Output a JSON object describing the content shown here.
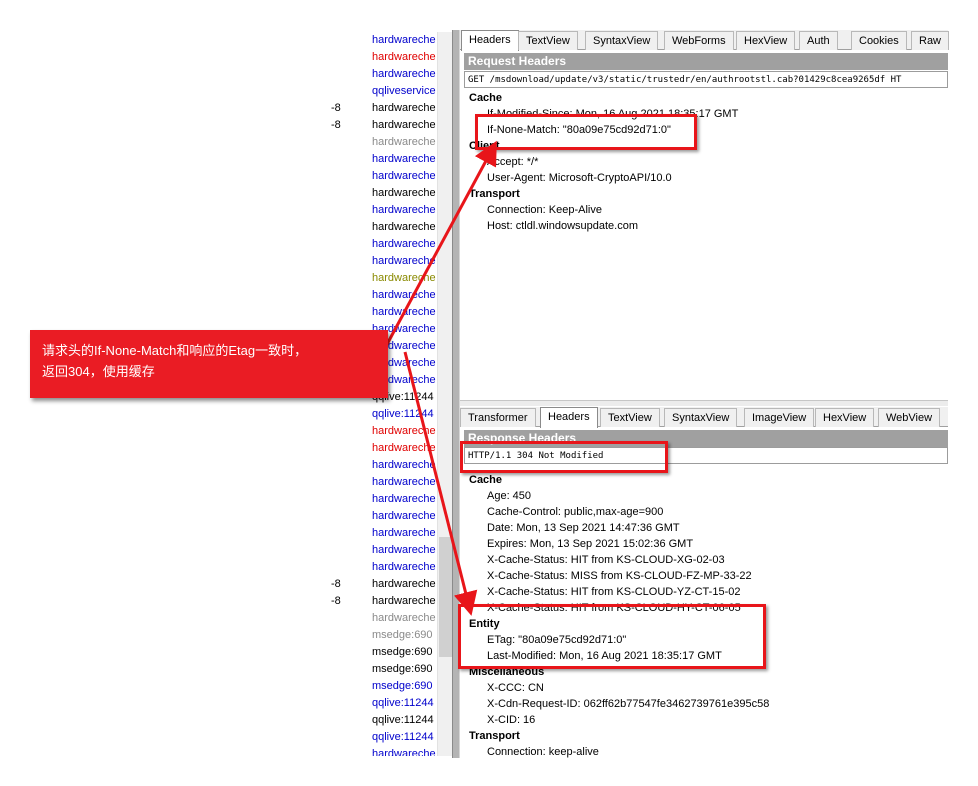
{
  "session_list": {
    "rows": [
      {
        "prefix": "",
        "host": "hardwareche",
        "color": "#0000cc"
      },
      {
        "prefix": "",
        "host": "hardwareche",
        "color": "#e00000"
      },
      {
        "prefix": "",
        "host": "hardwareche",
        "color": "#0000cc"
      },
      {
        "prefix": "",
        "host": "qqliveservice",
        "color": "#0000cc"
      },
      {
        "prefix": "-8",
        "host": "hardwareche",
        "color": "#000000"
      },
      {
        "prefix": "-8",
        "host": "hardwareche",
        "color": "#000000"
      },
      {
        "prefix": "",
        "host": "hardwareche",
        "color": "#8a8a8a"
      },
      {
        "prefix": "",
        "host": "hardwareche",
        "color": "#0000cc"
      },
      {
        "prefix": "",
        "host": "hardwareche",
        "color": "#0000cc"
      },
      {
        "prefix": "",
        "host": "hardwareche",
        "color": "#000000"
      },
      {
        "prefix": "",
        "host": "hardwareche",
        "color": "#0000cc"
      },
      {
        "prefix": "",
        "host": "hardwareche",
        "color": "#000000"
      },
      {
        "prefix": "",
        "host": "hardwareche",
        "color": "#0000cc"
      },
      {
        "prefix": "",
        "host": "hardwareche",
        "color": "#0000cc"
      },
      {
        "prefix": "",
        "host": "hardwareche",
        "color": "#8a8a00"
      },
      {
        "prefix": "",
        "host": "hardwareche",
        "color": "#0000cc"
      },
      {
        "prefix": "",
        "host": "hardwareche",
        "color": "#0000cc"
      },
      {
        "prefix": "",
        "host": "hardwareche",
        "color": "#0000cc"
      },
      {
        "prefix": "",
        "host": "hardwareche",
        "color": "#0000cc"
      },
      {
        "prefix": "",
        "host": "hardwareche",
        "color": "#0000cc"
      },
      {
        "prefix": "",
        "host": "hardwareche",
        "color": "#0000cc"
      },
      {
        "prefix": "",
        "host": "qqlive:11244",
        "color": "#000000"
      },
      {
        "prefix": "",
        "host": "qqlive:11244",
        "color": "#0000cc"
      },
      {
        "prefix": "",
        "host": "hardwareche",
        "color": "#e00000"
      },
      {
        "prefix": "",
        "host": "hardwareche",
        "color": "#e00000"
      },
      {
        "prefix": "",
        "host": "hardwareche",
        "color": "#0000cc"
      },
      {
        "prefix": "",
        "host": "hardwareche",
        "color": "#0000cc"
      },
      {
        "prefix": "",
        "host": "hardwareche",
        "color": "#0000cc"
      },
      {
        "prefix": "",
        "host": "hardwareche",
        "color": "#0000cc"
      },
      {
        "prefix": "",
        "host": "hardwareche",
        "color": "#0000cc"
      },
      {
        "prefix": "",
        "host": "hardwareche",
        "color": "#0000cc"
      },
      {
        "prefix": "",
        "host": "hardwareche",
        "color": "#0000cc"
      },
      {
        "prefix": "-8",
        "host": "hardwareche",
        "color": "#000000"
      },
      {
        "prefix": "-8",
        "host": "hardwareche",
        "color": "#000000"
      },
      {
        "prefix": "",
        "host": "hardwareche",
        "color": "#8a8a8a"
      },
      {
        "prefix": "",
        "host": "msedge:690",
        "color": "#8a8a8a"
      },
      {
        "prefix": "",
        "host": "msedge:690",
        "color": "#000000"
      },
      {
        "prefix": "",
        "host": "msedge:690",
        "color": "#000000"
      },
      {
        "prefix": "",
        "host": "msedge:690",
        "color": "#0000cc"
      },
      {
        "prefix": "",
        "host": "qqlive:11244",
        "color": "#0000cc"
      },
      {
        "prefix": "",
        "host": "qqlive:11244",
        "color": "#000000"
      },
      {
        "prefix": "",
        "host": "qqlive:11244",
        "color": "#0000cc"
      },
      {
        "prefix": "",
        "host": "hardwareche",
        "color": "#0000cc"
      }
    ]
  },
  "request": {
    "tabs": [
      {
        "label": "Headers",
        "active": true
      },
      {
        "label": "TextView",
        "active": false
      },
      {
        "label": "SyntaxView",
        "active": false
      },
      {
        "label": "WebForms",
        "active": false
      },
      {
        "label": "HexView",
        "active": false
      },
      {
        "label": "Auth",
        "active": false
      },
      {
        "label": "Cookies",
        "active": false
      },
      {
        "label": "Raw",
        "active": false
      }
    ],
    "section_title": "Request Headers",
    "request_line": "GET /msdownload/update/v3/static/trustedr/en/authrootstl.cab?01429c8cea9265df HT",
    "groups": [
      {
        "name": "Cache",
        "items": [
          "If-Modified-Since: Mon, 16 Aug 2021 18:35:17 GMT",
          "If-None-Match: \"80a09e75cd92d71:0\""
        ]
      },
      {
        "name": "Client",
        "items": [
          "Accept: */*",
          "User-Agent: Microsoft-CryptoAPI/10.0"
        ]
      },
      {
        "name": "Transport",
        "items": [
          "Connection: Keep-Alive",
          "Host: ctldl.windowsupdate.com"
        ]
      }
    ]
  },
  "response": {
    "tabs": [
      {
        "label": "Transformer",
        "active": false
      },
      {
        "label": "Headers",
        "active": true
      },
      {
        "label": "TextView",
        "active": false
      },
      {
        "label": "SyntaxView",
        "active": false
      },
      {
        "label": "ImageView",
        "active": false
      },
      {
        "label": "HexView",
        "active": false
      },
      {
        "label": "WebView",
        "active": false
      }
    ],
    "section_title": "Response Headers",
    "status_line": "HTTP/1.1 304 Not Modified",
    "groups": [
      {
        "name": "Cache",
        "items": [
          "Age: 450",
          "Cache-Control: public,max-age=900",
          "Date: Mon, 13 Sep 2021 14:47:36 GMT",
          "Expires: Mon, 13 Sep 2021 15:02:36 GMT",
          "X-Cache-Status: HIT from KS-CLOUD-XG-02-03",
          "X-Cache-Status: MISS from KS-CLOUD-FZ-MP-33-22",
          "X-Cache-Status: HIT from KS-CLOUD-YZ-CT-15-02",
          "X-Cache-Status: HIT from KS-CLOUD-HY-CT-06-05"
        ]
      },
      {
        "name": "Entity",
        "items": [
          "ETag: \"80a09e75cd92d71:0\"",
          "Last-Modified: Mon, 16 Aug 2021 18:35:17 GMT"
        ]
      },
      {
        "name": "Miscellaneous",
        "items": [
          "X-CCC: CN",
          "X-Cdn-Request-ID: 062ff62b77547fe3462739761e395c58",
          "X-CID: 16"
        ]
      },
      {
        "name": "Transport",
        "items": [
          "Connection: keep-alive"
        ]
      }
    ]
  },
  "annotation": {
    "line1": "请求头的If-None-Match和响应的Etag一致时，",
    "line2": "返回304，使用缓存"
  },
  "colors": {
    "highlight": "#e8151a",
    "callout": "#ea1c24"
  }
}
